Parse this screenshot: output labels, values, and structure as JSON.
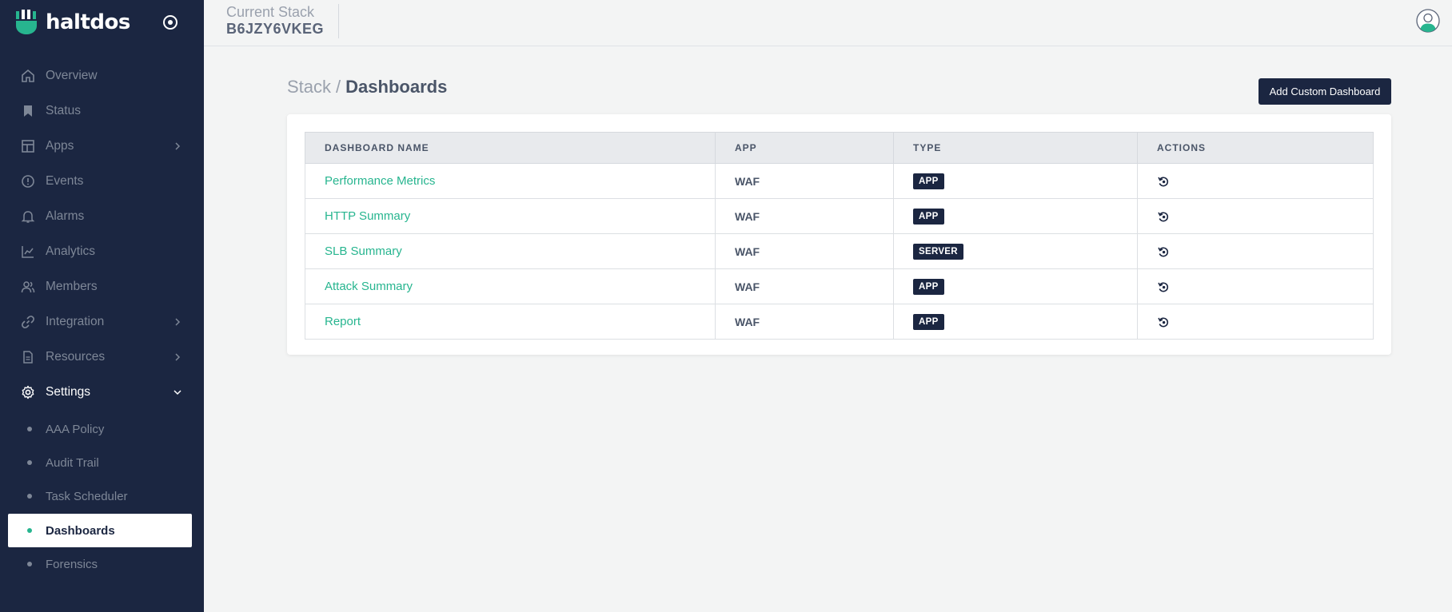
{
  "brand": {
    "name": "haltdos",
    "accent": "#27b58f",
    "sidebar_bg": "#1b2641"
  },
  "header": {
    "stack_label": "Current Stack",
    "stack_code": "B6JZY6VKEG"
  },
  "sidebar": {
    "items": [
      {
        "label": "Overview",
        "icon": "home-icon"
      },
      {
        "label": "Status",
        "icon": "bookmark-icon"
      },
      {
        "label": "Apps",
        "icon": "layout-icon",
        "has_submenu": true
      },
      {
        "label": "Events",
        "icon": "alert-circle-icon"
      },
      {
        "label": "Alarms",
        "icon": "bell-icon"
      },
      {
        "label": "Analytics",
        "icon": "chart-line-icon"
      },
      {
        "label": "Members",
        "icon": "users-icon"
      },
      {
        "label": "Integration",
        "icon": "link-icon",
        "has_submenu": true
      },
      {
        "label": "Resources",
        "icon": "file-icon",
        "has_submenu": true
      },
      {
        "label": "Settings",
        "icon": "gear-icon",
        "expanded": true
      }
    ],
    "settings_items": [
      {
        "label": "AAA Policy"
      },
      {
        "label": "Audit Trail"
      },
      {
        "label": "Task Scheduler"
      },
      {
        "label": "Dashboards",
        "active": true
      },
      {
        "label": "Forensics"
      }
    ]
  },
  "breadcrumb": {
    "root": "Stack",
    "separator": "/",
    "current": "Dashboards"
  },
  "actions": {
    "add_label": "Add Custom Dashboard"
  },
  "table": {
    "columns": [
      "DASHBOARD NAME",
      "APP",
      "TYPE",
      "ACTIONS"
    ],
    "rows": [
      {
        "name": "Performance Metrics",
        "app": "WAF",
        "type": "APP"
      },
      {
        "name": "HTTP Summary",
        "app": "WAF",
        "type": "APP"
      },
      {
        "name": "SLB Summary",
        "app": "WAF",
        "type": "SERVER"
      },
      {
        "name": "Attack Summary",
        "app": "WAF",
        "type": "APP"
      },
      {
        "name": "Report",
        "app": "WAF",
        "type": "APP"
      }
    ]
  }
}
